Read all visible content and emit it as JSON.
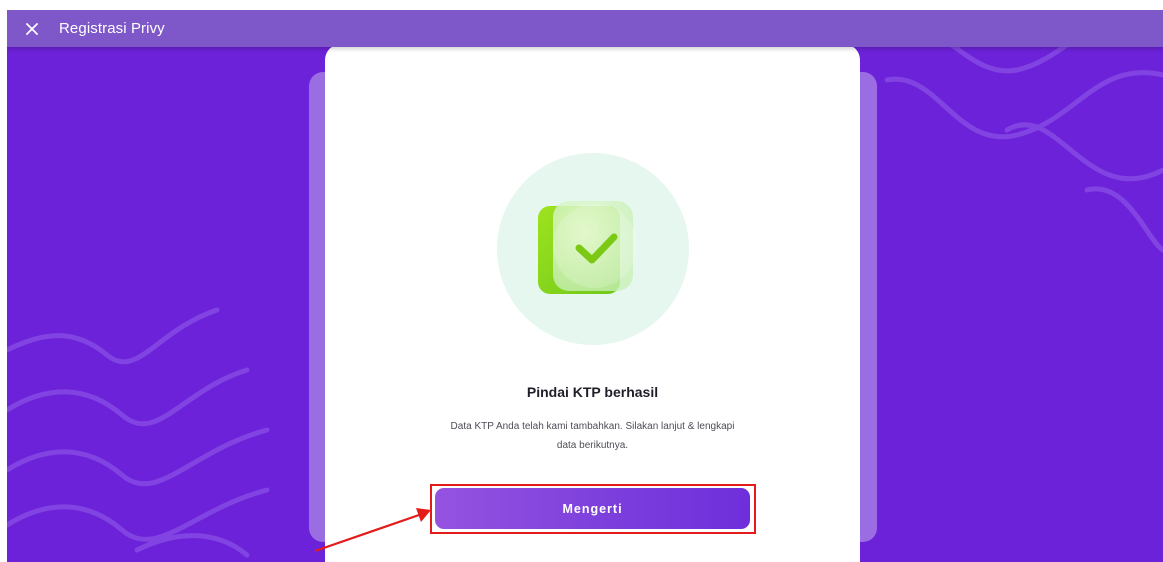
{
  "topbar": {
    "title": "Registrasi Privy",
    "close_icon": "close-icon"
  },
  "success": {
    "illustration_icon": "checkmark-icon",
    "heading": "Pindai KTP berhasil",
    "description": "Data KTP Anda telah kami tambahkan. Silakan lanjut & lengkapi data berikutnya."
  },
  "actions": {
    "confirm_label": "Mengerti"
  },
  "colors": {
    "background": "#6c22d8",
    "topbar": "#7e57c9",
    "button": "#7c3fdc",
    "success_green": "#8fd91a",
    "annotation": "#e41b1b"
  }
}
